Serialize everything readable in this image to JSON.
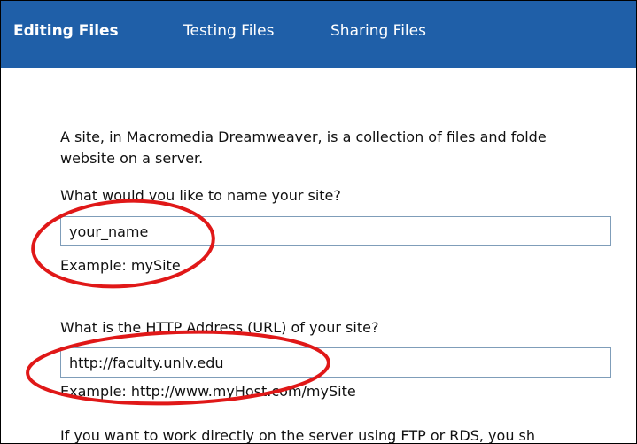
{
  "tabs": [
    {
      "label": "Editing Files",
      "active": true
    },
    {
      "label": "Testing Files",
      "active": false
    },
    {
      "label": "Sharing Files",
      "active": false
    }
  ],
  "intro": {
    "line1": "A site, in Macromedia Dreamweaver, is a collection of files and folde",
    "line2": "website on a server."
  },
  "site_name": {
    "question": "What would you like to name your site?",
    "value": "your_name",
    "example": "Example: mySite"
  },
  "site_url": {
    "question": "What is the HTTP Address (URL) of your site?",
    "value": "http://faculty.unlv.edu",
    "example": "Example: http://www.myHost.com/mySite"
  },
  "bottom_text": "If you want to work directly on the server using FTP or RDS, you sh",
  "colors": {
    "tab_bar": "#1f5fa8",
    "annotation": "#e01818",
    "field_border": "#7f9db9"
  }
}
